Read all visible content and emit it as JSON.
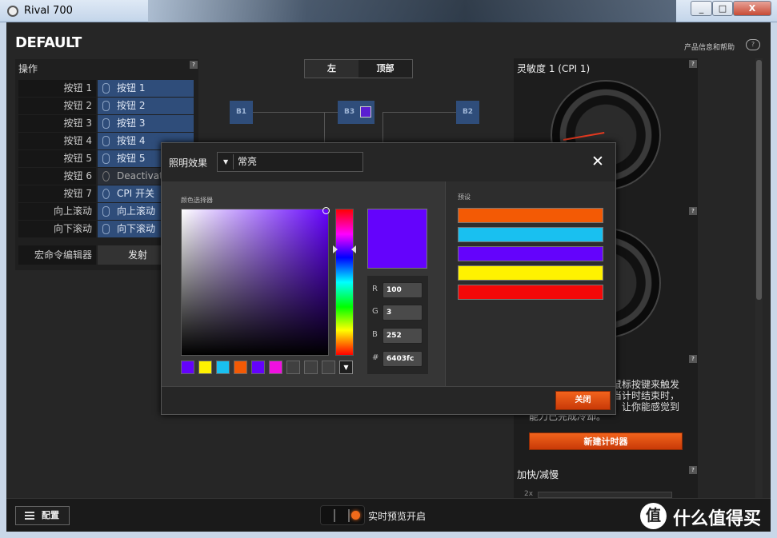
{
  "window": {
    "title": "Rival 700",
    "controls": [
      "_",
      "□",
      "X"
    ]
  },
  "profile": {
    "name": "DEFAULT"
  },
  "help": {
    "label": "产品信息和帮助",
    "icon": "chat-help-icon"
  },
  "actions_panel": {
    "title": "操作",
    "rows": [
      {
        "label": "按钮 1",
        "assignment": "按钮 1"
      },
      {
        "label": "按钮 2",
        "assignment": "按钮 2"
      },
      {
        "label": "按钮 3",
        "assignment": "按钮 3"
      },
      {
        "label": "按钮 4",
        "assignment": "按钮 4"
      },
      {
        "label": "按钮 5",
        "assignment": "按钮 5"
      },
      {
        "label": "按钮 6",
        "assignment": "Deactivat"
      },
      {
        "label": "按钮 7",
        "assignment": "CPI 开关"
      },
      {
        "label": "向上滚动",
        "assignment": "向上滚动"
      },
      {
        "label": "向下滚动",
        "assignment": "向下滚动"
      }
    ],
    "macro_label": "宏命令编辑器",
    "macro_button": "发射"
  },
  "view_tabs": {
    "left": "左",
    "top": "顶部"
  },
  "diagram_nodes": {
    "b1": "B1",
    "b2": "B2",
    "b3": "B3"
  },
  "right_panel": {
    "sensitivity_title": "灵敏度 1 (CPI 1)",
    "timer_desc_1": "鼠标按键来触发",
    "timer_desc_2": "当计时结束时，",
    "timer_desc_3": "，让你能感觉到",
    "timer_desc_4": "能力已完成冷却。",
    "new_timer_button": "新建计时器",
    "accel_title": "加快/减慢",
    "accel_tick": "2x"
  },
  "bottom": {
    "config_button": "配置",
    "live_preview_label": "实时预览开启",
    "watermark_logo": "值",
    "watermark_text": "什么值得买"
  },
  "dialog": {
    "effect_label": "照明效果",
    "effect_value": "常亮",
    "picker_label": "颜色选择器",
    "preset_label": "预设",
    "current_color": "#6403fc",
    "rgb": {
      "r_label": "R",
      "r": "100",
      "g_label": "G",
      "g": "3",
      "b_label": "B",
      "b": "252",
      "hex_label": "#",
      "hex": "6403fc"
    },
    "recent_swatches": [
      "#6403fc",
      "#fff200",
      "#19c0f0",
      "#f35a05",
      "#6403fc",
      "#f010e0",
      "#404040",
      "#404040",
      "#404040"
    ],
    "presets": [
      "#f35a05",
      "#19c0f0",
      "#6403fc",
      "#fff200",
      "#f30808"
    ],
    "close_button": "关闭"
  }
}
